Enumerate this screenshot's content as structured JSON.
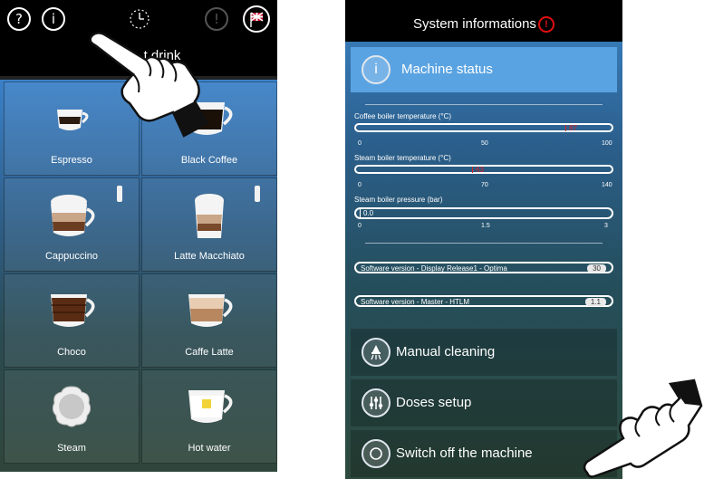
{
  "left_screen": {
    "topbar": {
      "help_icon": "?",
      "info_icon": "i"
    },
    "title": "Select drink",
    "title_visible_part": "t drink",
    "drinks": [
      {
        "label": "Espresso"
      },
      {
        "label": "Black Coffee"
      },
      {
        "label": "Cappuccino"
      },
      {
        "label": "Latte Macchiato"
      },
      {
        "label": "Choco"
      },
      {
        "label": "Caffe Latte"
      },
      {
        "label": "Steam"
      },
      {
        "label": "Hot water"
      }
    ]
  },
  "right_screen": {
    "title": "System informations",
    "alert_icon": "!",
    "machine_status": "Machine status",
    "gauges": [
      {
        "label": "Coffee boiler temperature (°C)",
        "value": "87",
        "min": "0",
        "mid": "50",
        "max": "100",
        "fraction": 0.87
      },
      {
        "label": "Steam boiler temperature (°C)",
        "value": "63",
        "min": "0",
        "mid": "70",
        "max": "140",
        "fraction": 0.45
      },
      {
        "label": "Steam boiler pressure (bar)",
        "value": "0.0",
        "min": "0",
        "mid": "1.5",
        "max": "3",
        "fraction": 0.0
      }
    ],
    "software": [
      {
        "label": "Software version - Display Release1 - Optima",
        "value": "30"
      },
      {
        "label": "Software version - Master - HTLM",
        "value": "1.1"
      }
    ],
    "menu": [
      {
        "label": "Manual cleaning"
      },
      {
        "label": "Doses setup"
      },
      {
        "label": "Switch off the machine"
      }
    ]
  }
}
